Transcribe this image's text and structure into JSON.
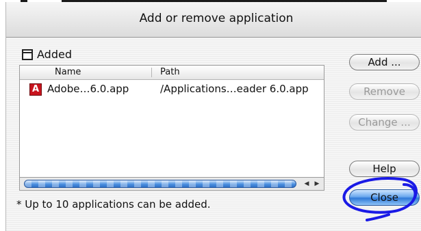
{
  "window": {
    "title": "Add or remove application"
  },
  "group": {
    "label": "Added",
    "icon": "window-icon"
  },
  "list": {
    "columns": [
      "Name",
      "Path"
    ],
    "rows": [
      {
        "icon": "adobe-reader-icon",
        "name": "Adobe…6.0.app",
        "path": "/Applications…eader 6.0.app"
      }
    ]
  },
  "note": "* Up to 10 applications can be added.",
  "buttons": {
    "add": "Add ...",
    "remove": "Remove",
    "change": "Change ...",
    "help": "Help",
    "close": "Close"
  },
  "colors": {
    "accent": "#3b80e0",
    "annotation": "#1a1ae6",
    "adobe_red": "#c8141e"
  }
}
